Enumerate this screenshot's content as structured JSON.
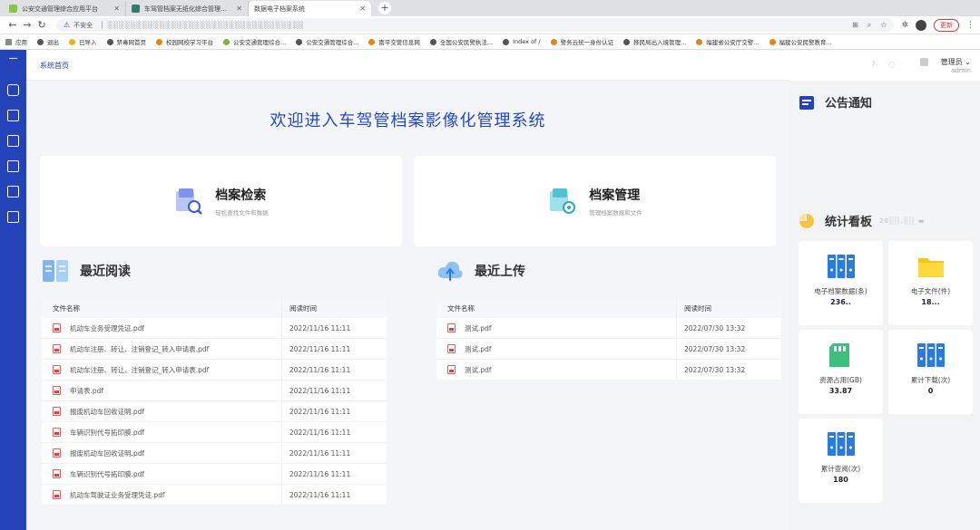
{
  "browser": {
    "tabs": [
      {
        "title": "公安交通管理综合应用平台",
        "color": "#8bc34a",
        "active": false
      },
      {
        "title": "车驾管档案无纸化综合管理系统",
        "color": "#2e7d6f",
        "active": false
      },
      {
        "title": "数据电子档案系统",
        "color": "",
        "active": true
      }
    ],
    "security_label": "不安全",
    "update_label": "更新",
    "bookmarks": [
      {
        "label": "应用",
        "color": "#888"
      },
      {
        "label": "退出",
        "color": "#555"
      },
      {
        "label": "已导入",
        "color": "#e6b422"
      },
      {
        "label": "禁毒网首页",
        "color": "#555"
      },
      {
        "label": "校园网校学习平台",
        "color": "#e0861b"
      },
      {
        "label": "公安交通管理综合...",
        "color": "#7cb342"
      },
      {
        "label": "公安交通管理综合...",
        "color": "#555"
      },
      {
        "label": "南平交管信息网",
        "color": "#e0861b"
      },
      {
        "label": "全国公安民警执法...",
        "color": "#555"
      },
      {
        "label": "Index of /",
        "color": "#555"
      },
      {
        "label": "警务云统一身份认证",
        "color": "#e0861b"
      },
      {
        "label": "移民局出入境管理...",
        "color": "#555"
      },
      {
        "label": "福建省公安厅交警...",
        "color": "#e0861b"
      },
      {
        "label": "福建公安民警教育...",
        "color": "#e0861b"
      }
    ]
  },
  "header": {
    "breadcrumb": "系统首页",
    "user_name": "管理员",
    "user_role": "admin"
  },
  "welcome": "欢迎进入车驾管档案影像化管理系统",
  "cards": [
    {
      "title": "档案检索",
      "subtitle": "轻松查找文件和数据"
    },
    {
      "title": "档案管理",
      "subtitle": "管理档案数据和文件"
    }
  ],
  "recent_read": {
    "title": "最近阅读",
    "col_name": "文件名称",
    "col_time": "阅读时间",
    "rows": [
      {
        "name": "机动车业务受理凭证.pdf",
        "time": "2022/11/16 11:11"
      },
      {
        "name": "机动车注册、转让、注销登记_转入申请表.pdf",
        "time": "2022/11/16 11:11"
      },
      {
        "name": "机动车注册、转让、注销登记_转入申请表.pdf",
        "time": "2022/11/16 11:11"
      },
      {
        "name": "申请表.pdf",
        "time": "2022/11/16 11:11"
      },
      {
        "name": "报废机动车回收证明.pdf",
        "time": "2022/11/16 11:11"
      },
      {
        "name": "车辆识别代号拓印膜.pdf",
        "time": "2022/11/16 11:11"
      },
      {
        "name": "报废机动车回收证明.pdf",
        "time": "2022/11/16 11:11"
      },
      {
        "name": "车辆识别代号拓印膜.pdf",
        "time": "2022/11/16 11:11"
      },
      {
        "name": "机动车驾驶证业务受理凭证.pdf",
        "time": "2022/11/16 11:11"
      }
    ]
  },
  "recent_upload": {
    "title": "最近上传",
    "col_name": "文件名称",
    "col_time": "阅读时间",
    "rows": [
      {
        "name": "测试.pdf",
        "time": "2022/07/30 13:32"
      },
      {
        "name": "测试.pdf",
        "time": "2022/07/30 13:32"
      },
      {
        "name": "测试.pdf",
        "time": "2022/07/30 13:32"
      }
    ]
  },
  "notice": {
    "title": "公告通知"
  },
  "stats": {
    "title": "统计看板",
    "items": [
      {
        "label": "电子档案数据(条)",
        "value": "236..",
        "icon": "binders-icon"
      },
      {
        "label": "电子文件(件)",
        "value": "18...",
        "icon": "folder-icon"
      },
      {
        "label": "资源占用(GB)",
        "value": "33.87",
        "icon": "sd-card-icon"
      },
      {
        "label": "累计下载(次)",
        "value": "0",
        "icon": "binders-icon"
      },
      {
        "label": "累计查阅(次)",
        "value": "180",
        "icon": "binders-icon"
      }
    ]
  },
  "colors": {
    "primary": "#2443b8",
    "accent": "#2a7be0"
  }
}
